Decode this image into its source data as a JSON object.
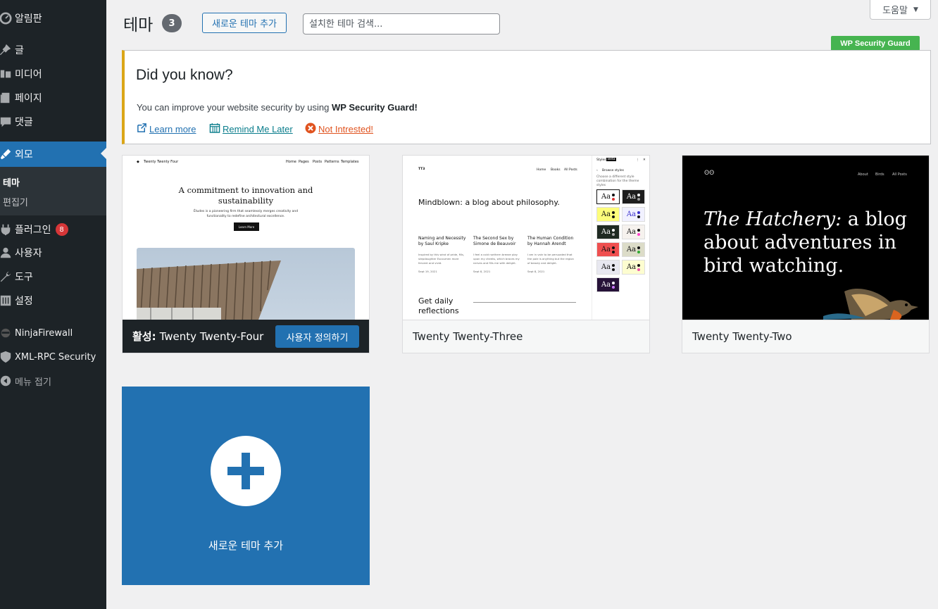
{
  "sidebar": {
    "items": [
      {
        "label": "알림판",
        "icon": "dashboard-icon"
      },
      {
        "label": "글",
        "icon": "pin-icon"
      },
      {
        "label": "미디어",
        "icon": "media-icon"
      },
      {
        "label": "페이지",
        "icon": "page-icon"
      },
      {
        "label": "댓글",
        "icon": "comment-icon"
      },
      {
        "label": "외모",
        "icon": "appearance-icon"
      },
      {
        "label": "플러그인",
        "icon": "plugin-icon",
        "badge": "8"
      },
      {
        "label": "사용자",
        "icon": "users-icon"
      },
      {
        "label": "도구",
        "icon": "tools-icon"
      },
      {
        "label": "설정",
        "icon": "settings-icon"
      },
      {
        "label": "NinjaFirewall",
        "icon": "ninja-icon"
      },
      {
        "label": "XML-RPC Security",
        "icon": "shield-icon"
      },
      {
        "label": "메뉴 접기",
        "icon": "collapse-icon"
      }
    ],
    "submenu": [
      {
        "label": "테마"
      },
      {
        "label": "편집기"
      }
    ]
  },
  "header": {
    "title": "테마",
    "count": "3",
    "add_new": "새로운 테마 추가",
    "search_placeholder": "설치한 테마 검색...",
    "help": "도움말"
  },
  "notice": {
    "tag": "WP Security Guard",
    "title": "Did you know?",
    "text_before": "You can improve your website security by using ",
    "text_bold": "WP Security Guard!",
    "links": {
      "learn": "Learn more",
      "remind": "Remind Me Later",
      "not_interested": "Not Intrested!"
    }
  },
  "themes": [
    {
      "name": "Twenty Twenty-Four",
      "active_label": "활성:",
      "customize": "사용자 정의하기",
      "preview": {
        "site": "Twenty Twenty Four",
        "nav": [
          "Home",
          "Pages",
          "Posts",
          "Patterns",
          "Templates"
        ],
        "headline": "A commitment to innovation and sustainability",
        "sub": "Études is a pioneering firm that seamlessly merges creativity and functionality to redefine architectural excellence.",
        "button": "Learn More"
      }
    },
    {
      "name": "Twenty Twenty-Three",
      "preview": {
        "site": "TT3",
        "nav": [
          "Home",
          "Books",
          "All Posts"
        ],
        "title": "Mindblown: a blog about philosophy.",
        "posts": [
          {
            "title": "Naming and Necessity by Saul Kripke",
            "text": "Inspired by this wind of pride, Mis, stepdaughter Escoumen more fervent and vivid.",
            "date": "Sept 19, 2021"
          },
          {
            "title": "The Second Sex by Simone de Beauvoir",
            "text": "I feel a cold northern breeze play upon my cheeks, which braces my nerves and fills me with delight.",
            "date": "Sept 8, 2021"
          },
          {
            "title": "The Human Condition by Hannah Arendt",
            "text": "I am in vain to be persuaded that the pole is anything but the region of beauty and delight.",
            "date": "Sept 8, 2021"
          }
        ],
        "footer_title": "Get daily reflections",
        "panel_title": "Styles",
        "panel_badge": "Beta",
        "panel_sub": "Browse styles",
        "panel_desc": "Choose a different style combination for the theme styles",
        "swatch_text": "Aa"
      }
    },
    {
      "name": "Twenty Twenty-Two",
      "preview": {
        "nav": [
          "About",
          "Birds",
          "All Posts"
        ],
        "title_italic": "The Hatchery:",
        "title_rest": " a blog about adventures in bird watching."
      }
    }
  ],
  "add_card": {
    "label": "새로운 테마 추가"
  },
  "colors": {
    "sidebar_bg": "#1d2327",
    "accent": "#2271b1",
    "notice_border": "#dba617",
    "tag_green": "#46b450",
    "badge_red": "#d63638"
  }
}
